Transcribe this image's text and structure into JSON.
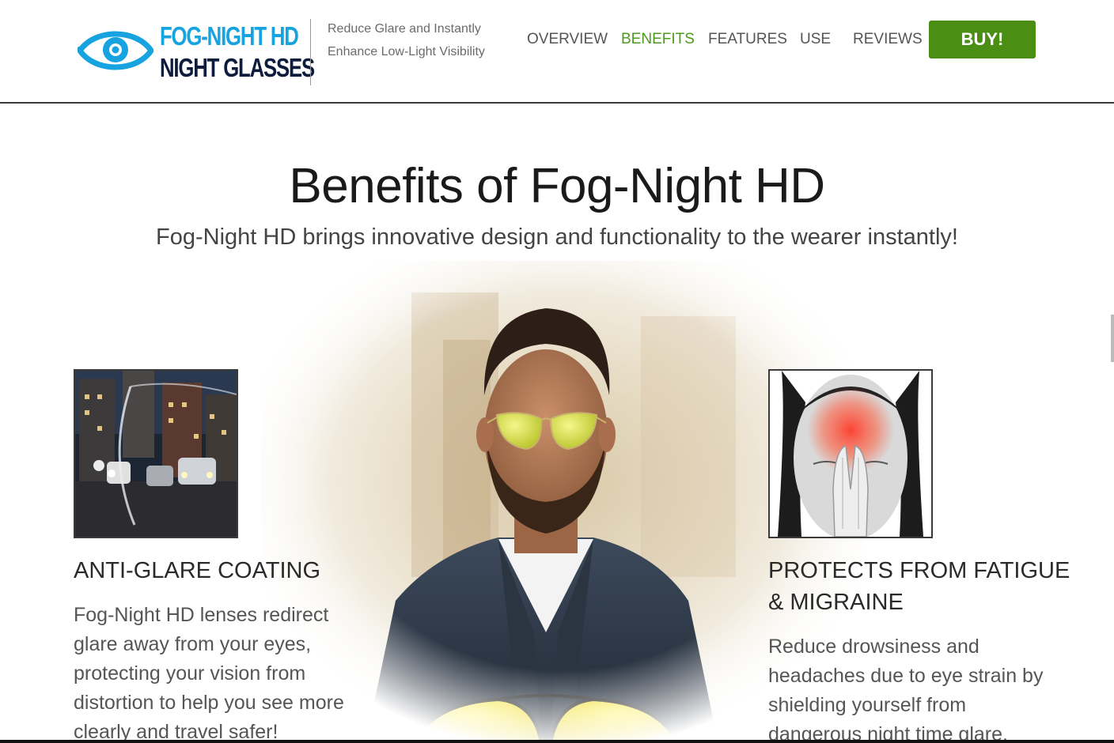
{
  "brand": {
    "line1_a": "FOG-NIGHT",
    "line1_b": " HD",
    "line2": "NIGHT GLASSES",
    "icon": "eye-icon",
    "colors": {
      "blue": "#16a3e0",
      "dark": "#0d1b3d"
    }
  },
  "tagline": {
    "line1": "Reduce Glare and Instantly",
    "line2": "Enhance Low-Light Visibility"
  },
  "nav": {
    "items": [
      {
        "label": "OVERVIEW",
        "active": false
      },
      {
        "label": "BENEFITS",
        "active": true
      },
      {
        "label": "FEATURES",
        "active": false
      },
      {
        "label": "USE",
        "active": false
      },
      {
        "label": "REVIEWS",
        "active": false
      }
    ],
    "buy_label": "BUY!",
    "active_color": "#4b9b1e",
    "buy_color": "#4a8e14"
  },
  "hero": {
    "title": "Benefits of Fog-Night HD",
    "subtitle": "Fog-Night HD brings innovative design and functionality to the wearer instantly!"
  },
  "features": {
    "left": {
      "title": "ANTI-GLARE COATING",
      "lines": [
        "Fog-Night HD lenses redirect",
        "glare away from your eyes,",
        "protecting your vision from",
        "distortion to help you see more",
        "clearly and travel safer!"
      ]
    },
    "right": {
      "title_lines": [
        "PROTECTS FROM FATIGUE",
        "& MIGRAINE"
      ],
      "lines": [
        "Reduce drowsiness and",
        "headaches due to eye strain by",
        "shielding yourself from",
        "dangerous night time glare."
      ]
    }
  }
}
